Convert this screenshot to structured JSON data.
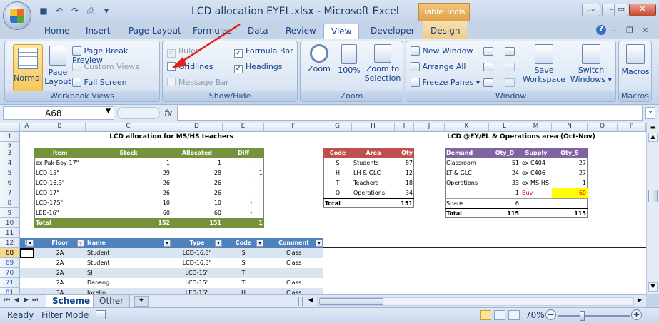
{
  "window": {
    "title": "LCD allocation EYEL.xlsx",
    "app": " - Microsoft Excel",
    "contextual": "Table Tools"
  },
  "tabs": [
    "Home",
    "Insert",
    "Page Layout",
    "Formulas",
    "Data",
    "Review",
    "View",
    "Developer",
    "Design"
  ],
  "ribbon": {
    "workbook_views": {
      "label": "Workbook Views",
      "normal": "Normal",
      "page_layout": "Page Layout",
      "page_break": "Page Break Preview",
      "custom_views": "Custom Views",
      "full_screen": "Full Screen"
    },
    "show_hide": {
      "label": "Show/Hide",
      "ruler": "Ruler",
      "gridlines": "Gridlines",
      "message_bar": "Message Bar",
      "formula_bar": "Formula Bar",
      "headings": "Headings"
    },
    "zoom": {
      "label": "Zoom",
      "zoom": "Zoom",
      "hundred": "100%",
      "selection": "Zoom to Selection"
    },
    "window": {
      "label": "Window",
      "new_window": "New Window",
      "arrange_all": "Arrange All",
      "freeze": "Freeze Panes",
      "save_ws": "Save Workspace",
      "switch": "Switch Windows"
    },
    "macros": {
      "label": "Macros",
      "macros": "Macros"
    }
  },
  "formula_bar": {
    "name_box": "A68",
    "fx": "fx",
    "value": ""
  },
  "columns": [
    "A",
    "B",
    "C",
    "D",
    "E",
    "F",
    "G",
    "H",
    "I",
    "J",
    "K",
    "L",
    "M",
    "N",
    "O",
    "P"
  ],
  "rows": [
    "1",
    "2",
    "3",
    "4",
    "5",
    "6",
    "7",
    "8",
    "9",
    "10",
    "11",
    "12",
    "68",
    "69",
    "70",
    "71",
    "81"
  ],
  "sheet": {
    "title_left": "LCD allocation for MS/HS teachers",
    "title_right": "LCD @EY/EL & Operations area (Oct-Nov)",
    "left_table": {
      "headers": [
        "Item",
        "Stock",
        "Allocated",
        "Diff"
      ],
      "rows": [
        [
          "ex Pak Boy-17\"",
          "1",
          "1",
          "-"
        ],
        [
          "LCD-15\"",
          "29",
          "28",
          "1"
        ],
        [
          "LCD-16.3\"",
          "26",
          "26",
          "-"
        ],
        [
          "LCD-17\"",
          "26",
          "26",
          "-"
        ],
        [
          "LCD-17S\"",
          "10",
          "10",
          "-"
        ],
        [
          "LED-16\"",
          "60",
          "60",
          "-"
        ]
      ],
      "total": [
        "Total",
        "152",
        "151",
        "1"
      ]
    },
    "code_table": {
      "headers": [
        "Code",
        "Area",
        "Qty"
      ],
      "rows": [
        [
          "S",
          "Students",
          "87"
        ],
        [
          "H",
          "LH & GLC",
          "12"
        ],
        [
          "T",
          "Teachers",
          "18"
        ],
        [
          "O",
          "Operations",
          "34"
        ]
      ],
      "total": [
        "Total",
        "",
        "151"
      ]
    },
    "demand_table": {
      "headers": [
        "Demand",
        "Qty_D",
        "Supply",
        "Qty_S"
      ],
      "rows": [
        [
          "Classroom",
          "51",
          "ex C404",
          "27"
        ],
        [
          "LT & GLC",
          "24",
          "ex C406",
          "27"
        ],
        [
          "Operations",
          "33",
          "ex MS-HS",
          "1"
        ],
        [
          "",
          "1",
          "Buy",
          "60"
        ],
        [
          "Spare",
          "6",
          "",
          ""
        ]
      ],
      "total": [
        "Total",
        "115",
        "",
        "115"
      ]
    },
    "list_table": {
      "headers": [
        "N",
        "Floor",
        "Name",
        "Type",
        "Code",
        "Comment"
      ],
      "rows": [
        [
          "",
          "2A",
          "Student",
          "LCD-16.3\"",
          "S",
          "Class"
        ],
        [
          "",
          "2A",
          "Student",
          "LCD-16.3\"",
          "S",
          "Class"
        ],
        [
          "",
          "2A",
          "SJ",
          "LCD-15\"",
          "T",
          ""
        ],
        [
          "",
          "2A",
          "Danang",
          "LCD-15\"",
          "T",
          "Class"
        ],
        [
          "",
          "3A",
          "Jocelin",
          "LED-16\"",
          "H",
          "Class"
        ]
      ]
    }
  },
  "sheet_tabs": [
    "Scheme",
    "Other"
  ],
  "status": {
    "ready": "Ready",
    "mode": "Filter Mode",
    "zoom": "70%"
  }
}
